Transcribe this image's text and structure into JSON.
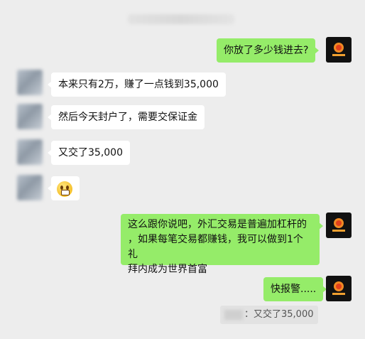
{
  "chat": {
    "messages": [
      {
        "side": "right",
        "text": "你放了多少钱进去?"
      },
      {
        "side": "left",
        "text": "本来只有2万，赚了一点钱到35,000"
      },
      {
        "side": "left",
        "text": "然后今天封户了，需要交保证金"
      },
      {
        "side": "left",
        "text": "又交了35,000"
      },
      {
        "side": "left",
        "emoji": "grimacing-face"
      },
      {
        "side": "right",
        "lines": [
          "这么跟你说吧，外汇交易是普遍加杠杆的",
          "，如果每笔交易都赚钱，我可以做到1个礼",
          "拜内成为世界首富"
        ]
      },
      {
        "side": "right",
        "text": "快报警....."
      }
    ],
    "quote": {
      "text": "：又交了35,000"
    }
  },
  "colors": {
    "background": "#ededed",
    "sent_bubble": "#95ec69",
    "received_bubble": "#ffffff"
  }
}
